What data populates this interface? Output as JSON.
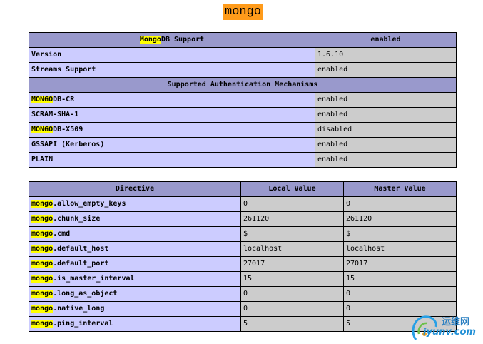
{
  "title": "mongo",
  "support": {
    "header_hl": "Mongo",
    "header_rest": "DB Support",
    "header_value": "enabled",
    "rows": [
      {
        "label_hl": "",
        "label": "Version",
        "value": "1.6.10"
      },
      {
        "label_hl": "",
        "label": "Streams Support",
        "value": "enabled"
      }
    ],
    "section_label": "Supported Authentication Mechanisms",
    "auth_rows": [
      {
        "label_hl": "MONGO",
        "label": "DB-CR",
        "value": "enabled"
      },
      {
        "label_hl": "",
        "label": "SCRAM-SHA-1",
        "value": "enabled"
      },
      {
        "label_hl": "MONGO",
        "label": "DB-X509",
        "value": "disabled"
      },
      {
        "label_hl": "",
        "label": "GSSAPI (Kerberos)",
        "value": "enabled"
      },
      {
        "label_hl": "",
        "label": "PLAIN",
        "value": "enabled"
      }
    ]
  },
  "directives": {
    "columns": [
      "Directive",
      "Local Value",
      "Master Value"
    ],
    "rows": [
      {
        "prefix": "mongo",
        "name": ".allow_empty_keys",
        "local": "0",
        "master": "0"
      },
      {
        "prefix": "mongo",
        "name": ".chunk_size",
        "local": "261120",
        "master": "261120"
      },
      {
        "prefix": "mongo",
        "name": ".cmd",
        "local": "$",
        "master": "$"
      },
      {
        "prefix": "mongo",
        "name": ".default_host",
        "local": "localhost",
        "master": "localhost"
      },
      {
        "prefix": "mongo",
        "name": ".default_port",
        "local": "27017",
        "master": "27017"
      },
      {
        "prefix": "mongo",
        "name": ".is_master_interval",
        "local": "15",
        "master": "15"
      },
      {
        "prefix": "mongo",
        "name": ".long_as_object",
        "local": "0",
        "master": "0"
      },
      {
        "prefix": "mongo",
        "name": ".native_long",
        "local": "0",
        "master": "0"
      },
      {
        "prefix": "mongo",
        "name": ".ping_interval",
        "local": "5",
        "master": "5"
      }
    ]
  },
  "watermark": {
    "line1": "运维网",
    "line2": "iyunv.com"
  }
}
